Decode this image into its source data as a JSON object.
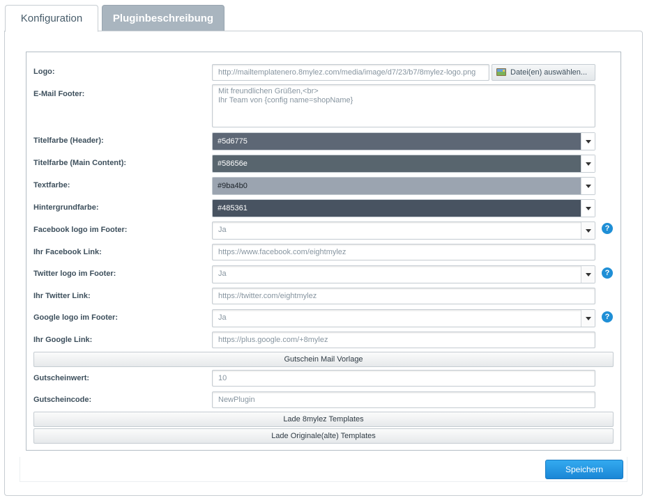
{
  "tabs": {
    "config": "Konfiguration",
    "description": "Pluginbeschreibung"
  },
  "form": {
    "logo": {
      "label": "Logo:",
      "value": "http://mailtemplatenero.8mylez.com/media/image/d7/23/b7/8mylez-logo.png",
      "button": "Datei(en) auswählen..."
    },
    "footer": {
      "label": "E-Mail Footer:",
      "line1": "Mit freundlichen Grüßen,<br>",
      "line2": "Ihr Team von {config name=shopName}"
    },
    "title_color": {
      "label": "Titelfarbe (Header):",
      "value": "#5d6775",
      "color": "#5d6775"
    },
    "main_color": {
      "label": "Titelfarbe (Main Content):",
      "value": "#58656e",
      "color": "#58656e"
    },
    "text_color": {
      "label": "Textfarbe:",
      "value": "#9ba4b0",
      "color": "#9ba4b0"
    },
    "bg_color": {
      "label": "Hintergrundfarbe:",
      "value": "#485361",
      "color": "#485361"
    },
    "facebook_logo": {
      "label": "Facebook logo im Footer:",
      "value": "Ja"
    },
    "facebook_link": {
      "label": "Ihr Facebook Link:",
      "value": "https://www.facebook.com/eightmylez"
    },
    "twitter_logo": {
      "label": "Twitter logo im Footer:",
      "value": "Ja"
    },
    "twitter_link": {
      "label": "Ihr Twitter Link:",
      "value": "https://twitter.com/eightmylez"
    },
    "google_logo": {
      "label": "Google logo im Footer:",
      "value": "Ja"
    },
    "google_link": {
      "label": "Ihr Google Link:",
      "value": "https://plus.google.com/+8mylez"
    },
    "voucher_section": "Gutschein Mail Vorlage",
    "voucher_value": {
      "label": "Gutscheinwert:",
      "value": "10"
    },
    "voucher_code": {
      "label": "Gutscheincode:",
      "value": "NewPlugin"
    },
    "load_templates": "Lade 8mylez Templates",
    "load_original": "Lade Originale(alte) Templates",
    "help_glyph": "?"
  },
  "save": "Speichern",
  "icons": {
    "file": "image-file-icon",
    "help": "help-icon",
    "dropdown": "chevron-down-icon"
  }
}
